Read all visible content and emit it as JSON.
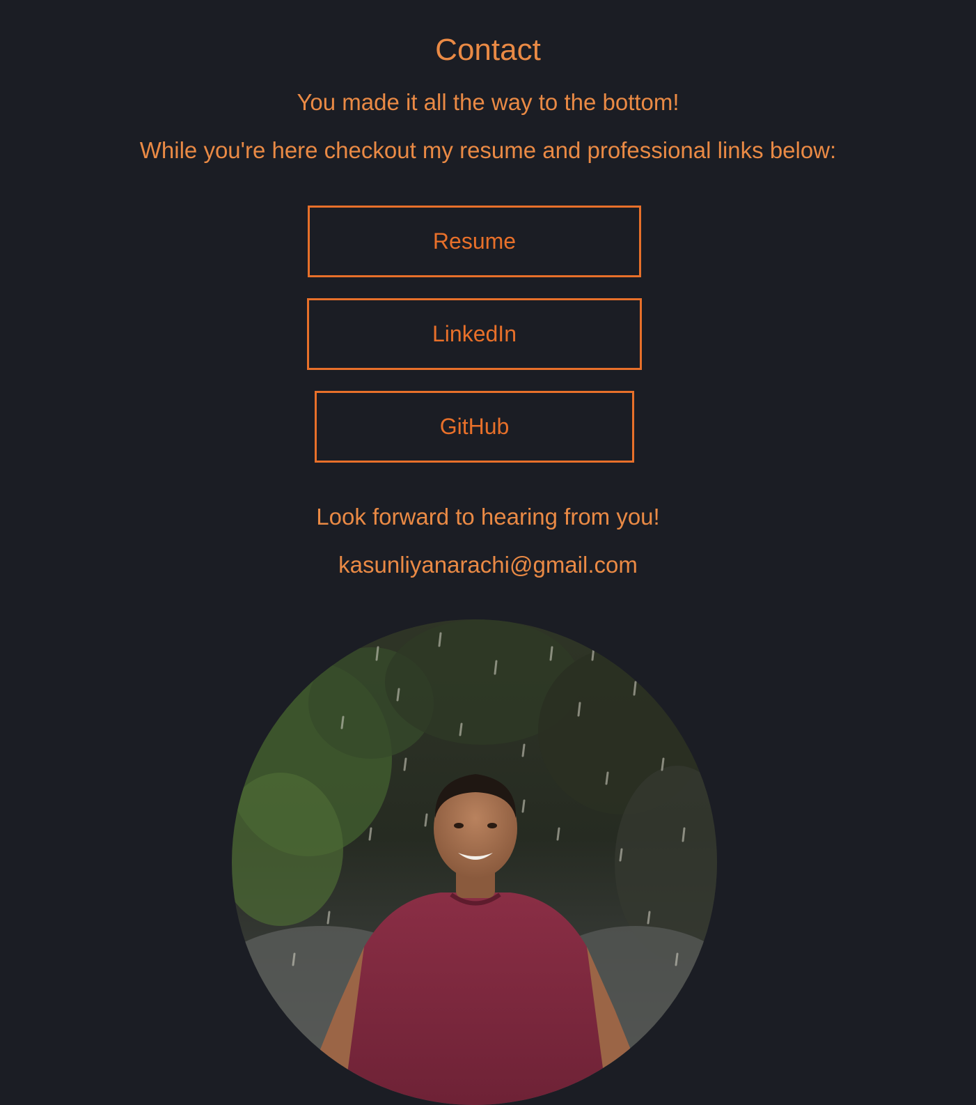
{
  "contact": {
    "title": "Contact",
    "intro_line_1": "You made it all the way to the bottom!",
    "intro_line_2": "While you're here checkout my resume and professional links below:",
    "buttons": [
      {
        "label": "Resume"
      },
      {
        "label": "LinkedIn"
      },
      {
        "label": "GitHub"
      }
    ],
    "closing_line": "Look forward to hearing from you!",
    "email": "kasunliyanarachi@gmail.com"
  },
  "photo": {
    "description_icon": "profile-photo"
  },
  "colors": {
    "background": "#1b1d24",
    "accent_text": "#ea8a45",
    "button_border": "#e8702a"
  }
}
